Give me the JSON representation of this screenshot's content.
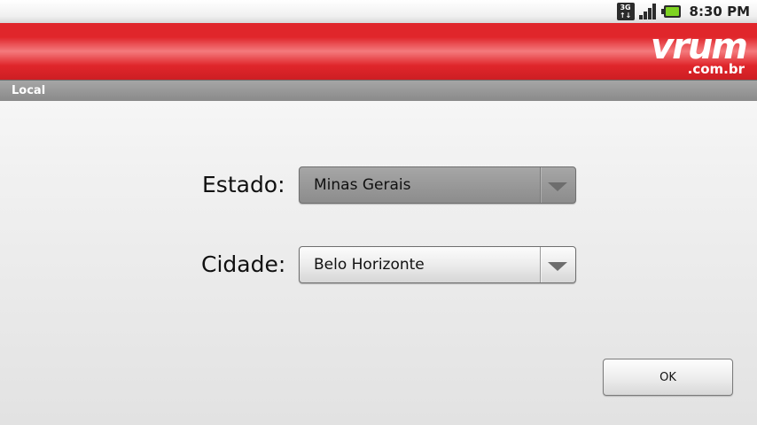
{
  "status_bar": {
    "network_label_top": "3G",
    "network_label_bottom": "↑↓",
    "time": "8:30 PM",
    "icons": [
      "3g-data-icon",
      "signal-strength-icon",
      "battery-icon"
    ],
    "battery_color": "#7ed321"
  },
  "header": {
    "brand_color": "#e0262b",
    "logo_main": "vrum",
    "logo_domain": ".com.br"
  },
  "section": {
    "title": "Local"
  },
  "form": {
    "estado_label": "Estado:",
    "estado_value": "Minas Gerais",
    "cidade_label": "Cidade:",
    "cidade_value": "Belo Horizonte"
  },
  "actions": {
    "ok_label": "OK"
  }
}
